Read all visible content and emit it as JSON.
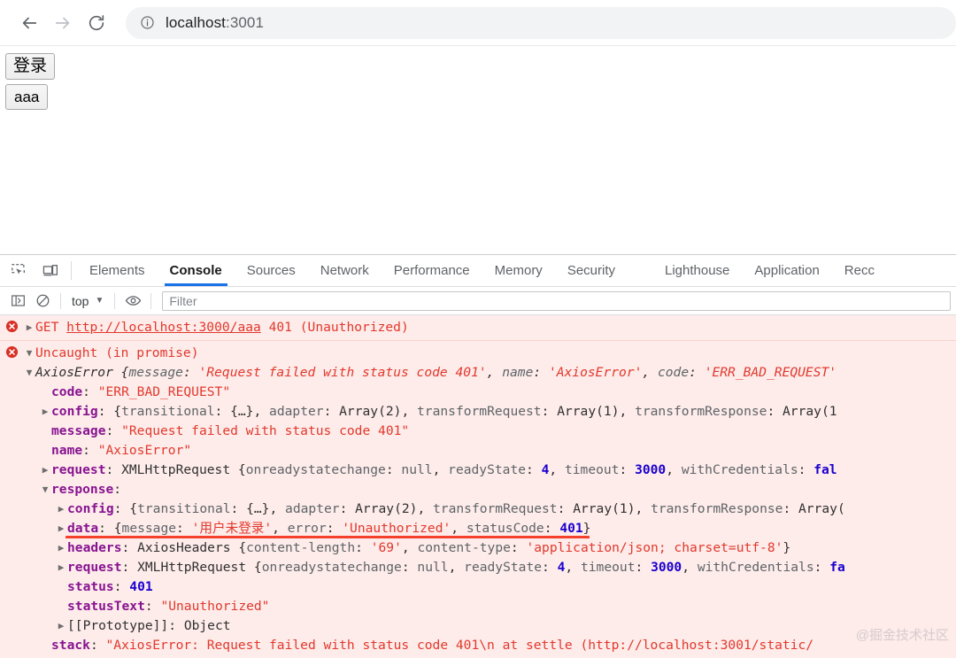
{
  "browser": {
    "nav": {
      "back_label": "Back",
      "forward_label": "Forward",
      "reload_label": "Reload"
    },
    "omnibox": {
      "site_info_icon": "info-circle-icon",
      "host": "localhost",
      "port": ":3001",
      "full_url": "localhost:3001"
    }
  },
  "page": {
    "buttons": [
      {
        "label": "登录"
      },
      {
        "label": "aaa"
      }
    ]
  },
  "devtools": {
    "tool_icons": [
      {
        "name": "inspect-element-icon"
      },
      {
        "name": "device-toolbar-icon"
      }
    ],
    "tabs": [
      {
        "label": "Elements",
        "active": false
      },
      {
        "label": "Console",
        "active": true
      },
      {
        "label": "Sources",
        "active": false
      },
      {
        "label": "Network",
        "active": false
      },
      {
        "label": "Performance",
        "active": false
      },
      {
        "label": "Memory",
        "active": false
      },
      {
        "label": "Security",
        "active": false
      },
      {
        "label": "Lighthouse",
        "active": false
      },
      {
        "label": "Application",
        "active": false
      },
      {
        "label": "Recc",
        "active": false
      }
    ],
    "console_toolbar": {
      "sidebar_icon": "console-sidebar-icon",
      "clear_icon": "clear-console-icon",
      "context_label": "top",
      "context_caret": "▼",
      "eye_icon": "live-expression-eye-icon",
      "filter_placeholder": "Filter"
    }
  },
  "console": {
    "watermark": "@掘金技术社区",
    "messages": [
      {
        "id": "network-401",
        "icon": "error-icon",
        "arrow": "▶",
        "text_parts": [
          {
            "t": "GET ",
            "k": "err"
          },
          {
            "t": "http://localhost:3000/aaa",
            "k": "link"
          },
          {
            "t": " 401 (Unauthorized)",
            "k": "err"
          }
        ]
      },
      {
        "id": "uncaught-promise",
        "icon": "error-icon",
        "arrow": "▼",
        "header": "Uncaught (in promise)",
        "lines": [
          {
            "indent": 1,
            "arrow": "▼",
            "italic": true,
            "parts": [
              {
                "t": "AxiosError ",
                "k": "class"
              },
              {
                "t": "{",
                "k": "plain"
              },
              {
                "t": "message",
                "k": "prop"
              },
              {
                "t": ": ",
                "k": "plain"
              },
              {
                "t": "'Request failed with status code 401'",
                "k": "str"
              },
              {
                "t": ", ",
                "k": "plain"
              },
              {
                "t": "name",
                "k": "prop"
              },
              {
                "t": ": ",
                "k": "plain"
              },
              {
                "t": "'AxiosError'",
                "k": "str"
              },
              {
                "t": ", ",
                "k": "plain"
              },
              {
                "t": "code",
                "k": "prop"
              },
              {
                "t": ": ",
                "k": "plain"
              },
              {
                "t": "'ERR_BAD_REQUEST'",
                "k": "str"
              }
            ]
          },
          {
            "indent": 2,
            "arrow": "",
            "parts": [
              {
                "t": "code",
                "k": "name"
              },
              {
                "t": ": ",
                "k": "plain"
              },
              {
                "t": "\"ERR_BAD_REQUEST\"",
                "k": "str"
              }
            ]
          },
          {
            "indent": 2,
            "arrow": "▶",
            "parts": [
              {
                "t": "config",
                "k": "name"
              },
              {
                "t": ": ",
                "k": "plain"
              },
              {
                "t": "{",
                "k": "plain"
              },
              {
                "t": "transitional",
                "k": "prop"
              },
              {
                "t": ": ",
                "k": "plain"
              },
              {
                "t": "{…}",
                "k": "plain"
              },
              {
                "t": ", ",
                "k": "plain"
              },
              {
                "t": "adapter",
                "k": "prop"
              },
              {
                "t": ": ",
                "k": "plain"
              },
              {
                "t": "Array(2)",
                "k": "plain"
              },
              {
                "t": ", ",
                "k": "plain"
              },
              {
                "t": "transformRequest",
                "k": "prop"
              },
              {
                "t": ": ",
                "k": "plain"
              },
              {
                "t": "Array(1)",
                "k": "plain"
              },
              {
                "t": ", ",
                "k": "plain"
              },
              {
                "t": "transformResponse",
                "k": "prop"
              },
              {
                "t": ": ",
                "k": "plain"
              },
              {
                "t": "Array(1",
                "k": "plain"
              }
            ]
          },
          {
            "indent": 2,
            "arrow": "",
            "parts": [
              {
                "t": "message",
                "k": "name"
              },
              {
                "t": ": ",
                "k": "plain"
              },
              {
                "t": "\"Request failed with status code 401\"",
                "k": "str"
              }
            ]
          },
          {
            "indent": 2,
            "arrow": "",
            "parts": [
              {
                "t": "name",
                "k": "name"
              },
              {
                "t": ": ",
                "k": "plain"
              },
              {
                "t": "\"AxiosError\"",
                "k": "str"
              }
            ]
          },
          {
            "indent": 2,
            "arrow": "▶",
            "parts": [
              {
                "t": "request",
                "k": "name"
              },
              {
                "t": ": ",
                "k": "plain"
              },
              {
                "t": "XMLHttpRequest ",
                "k": "plain"
              },
              {
                "t": "{",
                "k": "plain"
              },
              {
                "t": "onreadystatechange",
                "k": "prop"
              },
              {
                "t": ": ",
                "k": "plain"
              },
              {
                "t": "null",
                "k": "null"
              },
              {
                "t": ", ",
                "k": "plain"
              },
              {
                "t": "readyState",
                "k": "prop"
              },
              {
                "t": ": ",
                "k": "plain"
              },
              {
                "t": "4",
                "k": "num"
              },
              {
                "t": ", ",
                "k": "plain"
              },
              {
                "t": "timeout",
                "k": "prop"
              },
              {
                "t": ": ",
                "k": "plain"
              },
              {
                "t": "3000",
                "k": "num"
              },
              {
                "t": ", ",
                "k": "plain"
              },
              {
                "t": "withCredentials",
                "k": "prop"
              },
              {
                "t": ": ",
                "k": "plain"
              },
              {
                "t": "fal",
                "k": "num"
              }
            ]
          },
          {
            "indent": 2,
            "arrow": "▼",
            "parts": [
              {
                "t": "response",
                "k": "name"
              },
              {
                "t": ":",
                "k": "plain"
              }
            ]
          },
          {
            "indent": 3,
            "arrow": "▶",
            "parts": [
              {
                "t": "config",
                "k": "name"
              },
              {
                "t": ": ",
                "k": "plain"
              },
              {
                "t": "{",
                "k": "plain"
              },
              {
                "t": "transitional",
                "k": "prop"
              },
              {
                "t": ": ",
                "k": "plain"
              },
              {
                "t": "{…}",
                "k": "plain"
              },
              {
                "t": ", ",
                "k": "plain"
              },
              {
                "t": "adapter",
                "k": "prop"
              },
              {
                "t": ": ",
                "k": "plain"
              },
              {
                "t": "Array(2)",
                "k": "plain"
              },
              {
                "t": ", ",
                "k": "plain"
              },
              {
                "t": "transformRequest",
                "k": "prop"
              },
              {
                "t": ": ",
                "k": "plain"
              },
              {
                "t": "Array(1)",
                "k": "plain"
              },
              {
                "t": ", ",
                "k": "plain"
              },
              {
                "t": "transformResponse",
                "k": "prop"
              },
              {
                "t": ": ",
                "k": "plain"
              },
              {
                "t": "Array(",
                "k": "plain"
              }
            ]
          },
          {
            "indent": 3,
            "arrow": "▶",
            "annotated": true,
            "parts": [
              {
                "t": "data",
                "k": "name"
              },
              {
                "t": ": ",
                "k": "plain"
              },
              {
                "t": "{",
                "k": "plain"
              },
              {
                "t": "message",
                "k": "prop"
              },
              {
                "t": ": ",
                "k": "plain"
              },
              {
                "t": "'用户未登录'",
                "k": "str"
              },
              {
                "t": ", ",
                "k": "plain"
              },
              {
                "t": "error",
                "k": "prop"
              },
              {
                "t": ": ",
                "k": "plain"
              },
              {
                "t": "'Unauthorized'",
                "k": "str"
              },
              {
                "t": ", ",
                "k": "plain"
              },
              {
                "t": "statusCode",
                "k": "prop"
              },
              {
                "t": ": ",
                "k": "plain"
              },
              {
                "t": "401",
                "k": "num"
              },
              {
                "t": "}",
                "k": "plain"
              }
            ]
          },
          {
            "indent": 3,
            "arrow": "▶",
            "parts": [
              {
                "t": "headers",
                "k": "name"
              },
              {
                "t": ": ",
                "k": "plain"
              },
              {
                "t": "AxiosHeaders ",
                "k": "plain"
              },
              {
                "t": "{",
                "k": "plain"
              },
              {
                "t": "content-length",
                "k": "prop"
              },
              {
                "t": ": ",
                "k": "plain"
              },
              {
                "t": "'69'",
                "k": "str"
              },
              {
                "t": ", ",
                "k": "plain"
              },
              {
                "t": "content-type",
                "k": "prop"
              },
              {
                "t": ": ",
                "k": "plain"
              },
              {
                "t": "'application/json; charset=utf-8'",
                "k": "str"
              },
              {
                "t": "}",
                "k": "plain"
              }
            ]
          },
          {
            "indent": 3,
            "arrow": "▶",
            "parts": [
              {
                "t": "request",
                "k": "name"
              },
              {
                "t": ": ",
                "k": "plain"
              },
              {
                "t": "XMLHttpRequest ",
                "k": "plain"
              },
              {
                "t": "{",
                "k": "plain"
              },
              {
                "t": "onreadystatechange",
                "k": "prop"
              },
              {
                "t": ": ",
                "k": "plain"
              },
              {
                "t": "null",
                "k": "null"
              },
              {
                "t": ", ",
                "k": "plain"
              },
              {
                "t": "readyState",
                "k": "prop"
              },
              {
                "t": ": ",
                "k": "plain"
              },
              {
                "t": "4",
                "k": "num"
              },
              {
                "t": ", ",
                "k": "plain"
              },
              {
                "t": "timeout",
                "k": "prop"
              },
              {
                "t": ": ",
                "k": "plain"
              },
              {
                "t": "3000",
                "k": "num"
              },
              {
                "t": ", ",
                "k": "plain"
              },
              {
                "t": "withCredentials",
                "k": "prop"
              },
              {
                "t": ": ",
                "k": "plain"
              },
              {
                "t": "fa",
                "k": "num"
              }
            ]
          },
          {
            "indent": 3,
            "arrow": "",
            "parts": [
              {
                "t": "status",
                "k": "name"
              },
              {
                "t": ": ",
                "k": "plain"
              },
              {
                "t": "401",
                "k": "num"
              }
            ]
          },
          {
            "indent": 3,
            "arrow": "",
            "parts": [
              {
                "t": "statusText",
                "k": "name"
              },
              {
                "t": ": ",
                "k": "plain"
              },
              {
                "t": "\"Unauthorized\"",
                "k": "str"
              }
            ]
          },
          {
            "indent": 3,
            "arrow": "▶",
            "parts": [
              {
                "t": "[[Prototype]]",
                "k": "plain"
              },
              {
                "t": ": ",
                "k": "plain"
              },
              {
                "t": "Object",
                "k": "plain"
              }
            ]
          },
          {
            "indent": 2,
            "arrow": "",
            "parts": [
              {
                "t": "stack",
                "k": "name"
              },
              {
                "t": ": ",
                "k": "plain"
              },
              {
                "t": "\"AxiosError: Request failed with status code 401\\n    at settle (http://localhost:3001/static/",
                "k": "str"
              }
            ]
          }
        ]
      }
    ]
  }
}
